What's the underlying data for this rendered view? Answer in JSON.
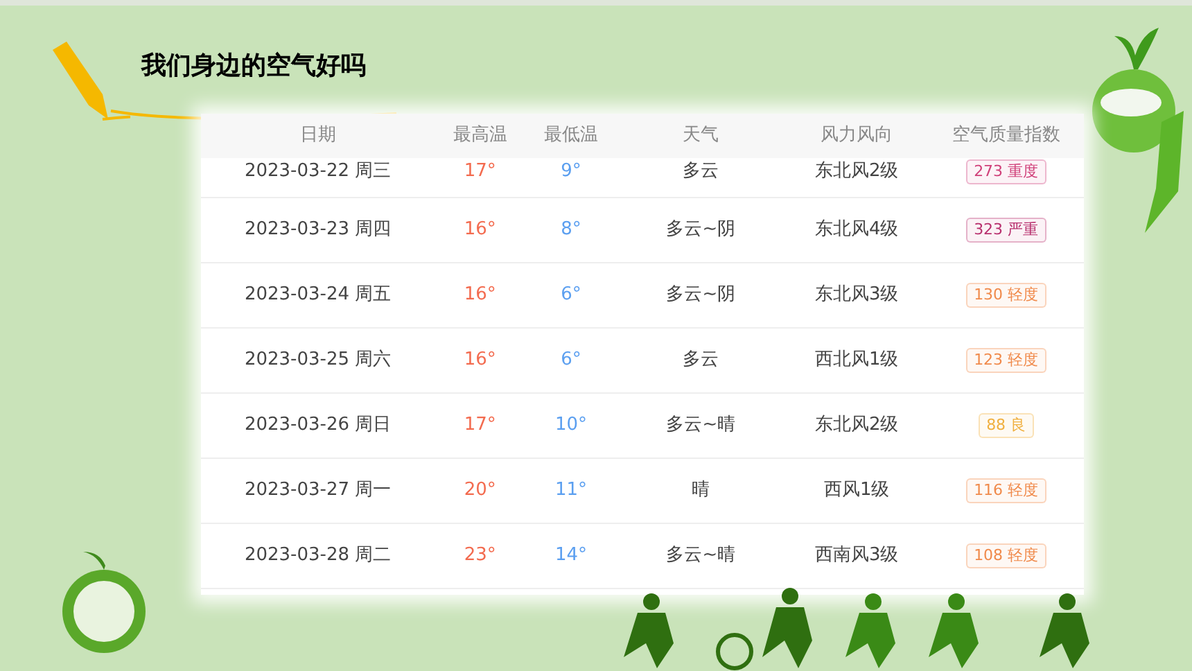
{
  "title": "我们身边的空气好吗",
  "table": {
    "columns": [
      "日期",
      "最高温",
      "最低温",
      "天气",
      "风力风向",
      "空气质量指数"
    ],
    "rows": [
      {
        "date": "2023-03-22 周三",
        "high": "17°",
        "low": "9°",
        "weather": "多云",
        "wind": "东北风2级",
        "aqi": "273 重度",
        "color": "#d0407a"
      },
      {
        "date": "2023-03-23 周四",
        "high": "16°",
        "low": "8°",
        "weather": "多云~阴",
        "wind": "东北风4级",
        "aqi": "323 严重",
        "color": "#b8306e"
      },
      {
        "date": "2023-03-24 周五",
        "high": "16°",
        "low": "6°",
        "weather": "多云~阴",
        "wind": "东北风3级",
        "aqi": "130 轻度",
        "color": "#f08a4b"
      },
      {
        "date": "2023-03-25 周六",
        "high": "16°",
        "low": "6°",
        "weather": "多云",
        "wind": "西北风1级",
        "aqi": "123 轻度",
        "color": "#f08a4b"
      },
      {
        "date": "2023-03-26 周日",
        "high": "17°",
        "low": "10°",
        "weather": "多云~晴",
        "wind": "东北风2级",
        "aqi": "88 良",
        "color": "#f0b040"
      },
      {
        "date": "2023-03-27 周一",
        "high": "20°",
        "low": "11°",
        "weather": "晴",
        "wind": "西风1级",
        "aqi": "116 轻度",
        "color": "#f08a4b"
      },
      {
        "date": "2023-03-28 周二",
        "high": "23°",
        "low": "14°",
        "weather": "多云~晴",
        "wind": "西南风3级",
        "aqi": "108 轻度",
        "color": "#f08a4b"
      }
    ]
  }
}
